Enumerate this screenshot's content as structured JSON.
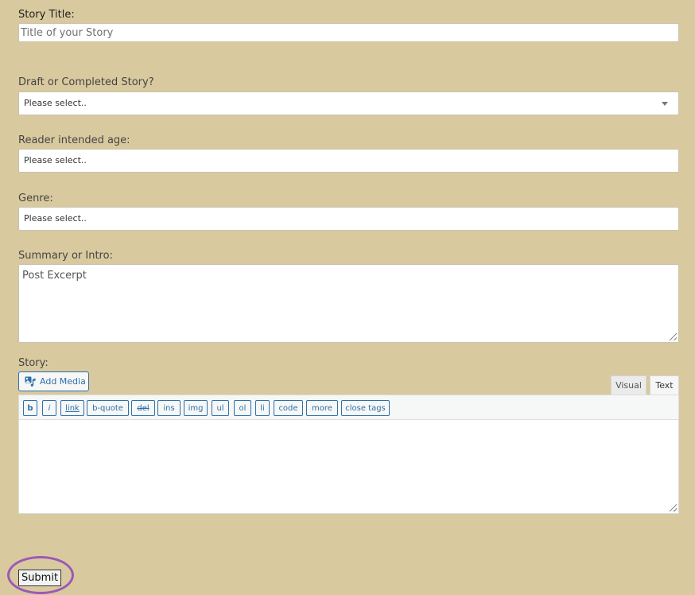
{
  "form": {
    "title_label": "Story Title:",
    "title_placeholder": "Title of your Story",
    "status_label": "Draft or Completed Story?",
    "status_value": "Please select..",
    "age_label": "Reader intended age:",
    "age_value": "Please select..",
    "genre_label": "Genre:",
    "genre_value": "Please select..",
    "summary_label": "Summary or Intro:",
    "summary_placeholder": "Post Excerpt",
    "story_label": "Story:"
  },
  "editor": {
    "add_media": "Add Media",
    "tabs": {
      "visual": "Visual",
      "text": "Text"
    },
    "buttons": {
      "b": "b",
      "i": "i",
      "link": "link",
      "bquote": "b-quote",
      "del": "del",
      "ins": "ins",
      "img": "img",
      "ul": "ul",
      "ol": "ol",
      "li": "li",
      "code": "code",
      "more": "more",
      "close": "close tags"
    }
  },
  "submit_label": "Submit",
  "colors": {
    "background": "#d9c99f",
    "accent": "#2f6fa7",
    "highlight": "#9b59b6"
  }
}
